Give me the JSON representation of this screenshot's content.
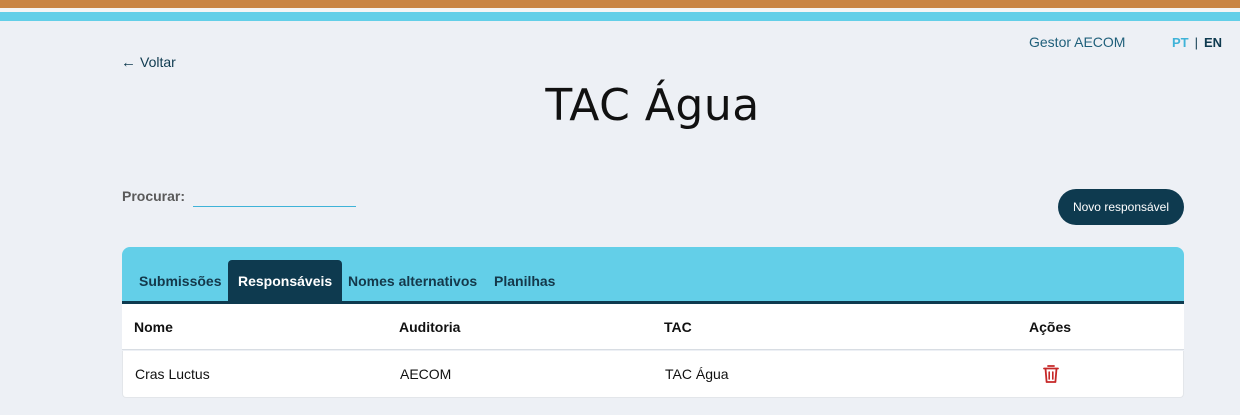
{
  "header": {
    "back_label": "Voltar",
    "user_name": "Gestor AECOM",
    "lang_pt": "PT",
    "lang_sep": "|",
    "lang_en": "EN"
  },
  "page": {
    "title": "TAC Água"
  },
  "search": {
    "label": "Procurar:",
    "value": ""
  },
  "actions": {
    "new_label": "Novo responsável"
  },
  "tabs": [
    {
      "label": "Submissões",
      "active": false
    },
    {
      "label": "Responsáveis",
      "active": true
    },
    {
      "label": "Nomes alternativos",
      "active": false
    },
    {
      "label": "Planilhas",
      "active": false
    }
  ],
  "table": {
    "columns": [
      "Nome",
      "Auditoria",
      "TAC",
      "Ações"
    ],
    "rows": [
      {
        "nome": "Cras Luctus",
        "auditoria": "AECOM",
        "tac": "TAC Água",
        "action_icon": "trash-icon"
      }
    ]
  },
  "colors": {
    "accent_dark": "#0e3a4f",
    "accent_light": "#63cfe8",
    "stripe_orange": "#c98544",
    "delete_red": "#c62828"
  }
}
